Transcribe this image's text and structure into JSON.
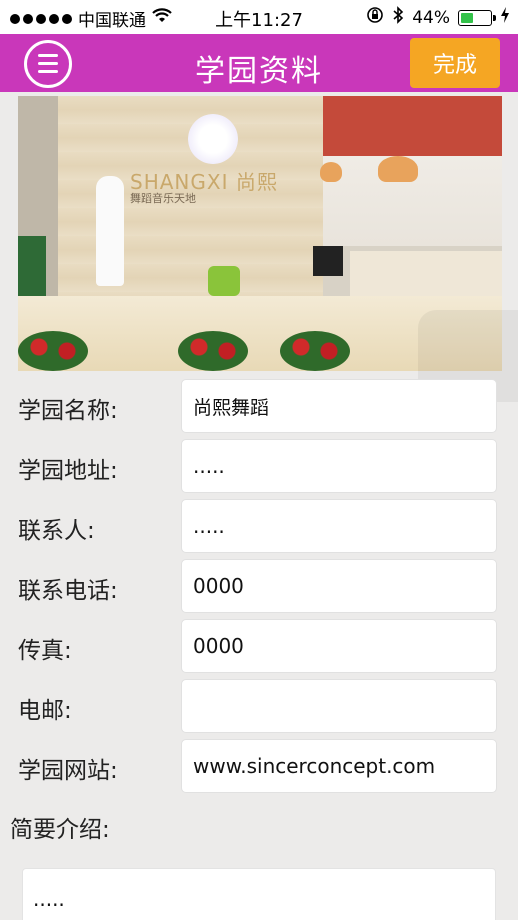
{
  "status_bar": {
    "carrier": "中国联通",
    "time": "上午11:27",
    "battery_percent": "44%",
    "battery_level": 0.44,
    "icons": [
      "signal-dots-icon",
      "wifi-icon",
      "orientation-lock-icon",
      "bluetooth-icon",
      "battery-icon",
      "charging-icon"
    ]
  },
  "navbar": {
    "title": "学园资料",
    "done_label": "完成",
    "menu_icon": "menu-icon",
    "colors": {
      "bar": "#c937ba",
      "done": "#f5a623"
    }
  },
  "photo": {
    "logo_text": "SHANGXI 尚熙",
    "logo_subtext": "舞蹈音乐天地"
  },
  "form": {
    "fields": [
      {
        "label": "学园名称:",
        "value": "尚熙舞蹈"
      },
      {
        "label": "学园地址:",
        "value": "....."
      },
      {
        "label": "联系人:",
        "value": "....."
      },
      {
        "label": "联系电话:",
        "value": "0000"
      },
      {
        "label": "传真:",
        "value": "0000"
      },
      {
        "label": "电邮:",
        "value": ""
      },
      {
        "label": "学园网站:",
        "value": "www.sincerconcept.com"
      }
    ],
    "intro_label": "简要介绍:",
    "intro_value": "....."
  }
}
